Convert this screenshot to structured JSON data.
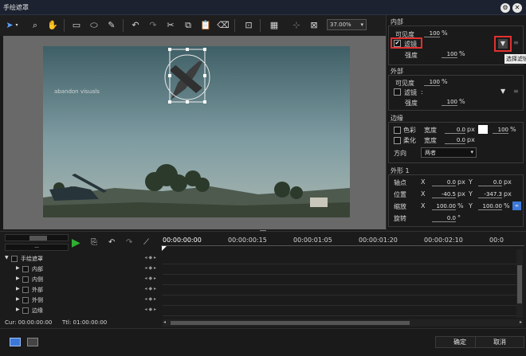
{
  "window": {
    "title": "手绘遮罩"
  },
  "toolbar": {
    "zoom": "37.00%"
  },
  "canvas": {
    "watermark": "abandon visuals"
  },
  "inner": {
    "header": "内部",
    "visibility_label": "可见度",
    "visibility_value": "100",
    "visibility_unit": "%",
    "filter_label": "滤镜",
    "filter_checked": true,
    "strength_label": "强度",
    "strength_value": "100",
    "strength_unit": "%",
    "tooltip": "选择滤镜"
  },
  "outer": {
    "header": "外部",
    "visibility_label": "可见度",
    "visibility_value": "100",
    "visibility_unit": "%",
    "filter_label": "滤镜",
    "filter_colon": ":",
    "strength_label": "强度",
    "strength_value": "100",
    "strength_unit": "%"
  },
  "edge": {
    "header": "边缘",
    "color_label": "色彩",
    "width_label": "宽度",
    "color_width": "0.0",
    "px": "px",
    "color_pct": "100",
    "pct": "%",
    "soft_label": "柔化",
    "soft_width": "0.0",
    "direction_label": "方向",
    "direction_value": "两者"
  },
  "shape": {
    "header": "外形 1",
    "anchor_label": "轴点",
    "anchor_x": "0.0",
    "anchor_y": "0.0",
    "position_label": "位置",
    "position_x": "-40.5",
    "position_y": "-347.3",
    "scale_label": "缩放",
    "scale_x": "100.00",
    "scale_y": "100.00",
    "rotate_label": "旋转",
    "rotate_value": "0.0",
    "x": "X",
    "y": "Y",
    "px": "px",
    "pct": "%",
    "deg": "°"
  },
  "timeline": {
    "ruler": [
      "00:00:00:00",
      "00:00:00:15",
      "00:00:01:05",
      "00:00:01:20",
      "00:00:02:10",
      "00:0"
    ],
    "tracks": [
      "手绘遮罩",
      "内部",
      "内侧",
      "外部",
      "外侧",
      "边缘"
    ],
    "cur": "Cur: 00:00:00:00",
    "ttl": "Ttl: 01:00:00:00"
  },
  "footer": {
    "ok": "确定",
    "cancel": "取消"
  },
  "colors": {
    "accent": "#3c78d8",
    "highlight": "#e23030",
    "play": "#2fb12f"
  }
}
